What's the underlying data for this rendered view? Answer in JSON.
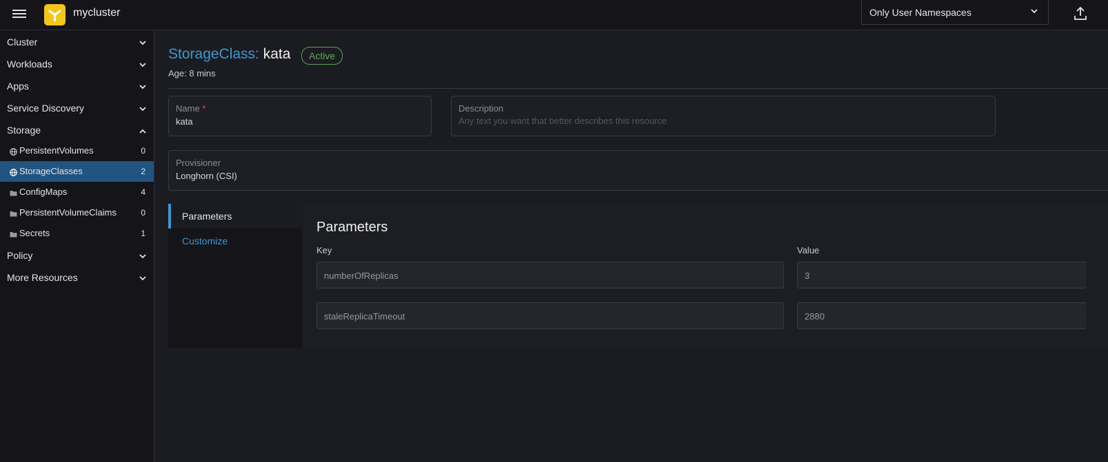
{
  "header": {
    "cluster_name": "mycluster",
    "namespace_filter": "Only User Namespaces",
    "accent": "#3d98d3",
    "logo_color": "#f5c518"
  },
  "sidebar": {
    "groups_top": [
      {
        "label": "Cluster"
      },
      {
        "label": "Workloads"
      },
      {
        "label": "Apps"
      },
      {
        "label": "Service Discovery"
      },
      {
        "label": "Storage"
      }
    ],
    "storage_items": [
      {
        "label": "PersistentVolumes",
        "count": "0",
        "icon": "globe-icon"
      },
      {
        "label": "StorageClasses",
        "count": "2",
        "icon": "globe-icon"
      },
      {
        "label": "ConfigMaps",
        "count": "4",
        "icon": "folder-icon"
      },
      {
        "label": "PersistentVolumeClaims",
        "count": "0",
        "icon": "folder-icon"
      },
      {
        "label": "Secrets",
        "count": "1",
        "icon": "folder-icon"
      }
    ],
    "groups_bottom": [
      {
        "label": "Policy"
      },
      {
        "label": "More Resources"
      }
    ]
  },
  "page": {
    "type_label": "StorageClass:",
    "name": "kata",
    "status": "Active",
    "status_color": "#5fa85a",
    "age": "Age: 8 mins"
  },
  "form": {
    "name_label": "Name",
    "name_required": "*",
    "name_value": "kata",
    "description_label": "Description",
    "description_placeholder": "Any text you want that better describes this resource",
    "provisioner_label": "Provisioner",
    "provisioner_value": "Longhorn (CSI)"
  },
  "tabs": [
    {
      "label": "Parameters"
    },
    {
      "label": "Customize"
    }
  ],
  "parameters": {
    "title": "Parameters",
    "key_header": "Key",
    "value_header": "Value",
    "rows": [
      {
        "key": "numberOfReplicas",
        "value": "3"
      },
      {
        "key": "staleReplicaTimeout",
        "value": "2880"
      }
    ]
  }
}
